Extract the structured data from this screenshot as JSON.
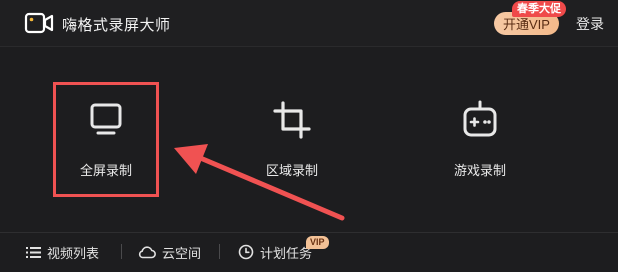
{
  "header": {
    "app_title": "嗨格式录屏大师",
    "vip_button": "开通VIP",
    "promo_badge": "春季大促",
    "login": "登录"
  },
  "options": [
    {
      "label": "全屏录制",
      "icon": "monitor-icon"
    },
    {
      "label": "区域录制",
      "icon": "crop-icon"
    },
    {
      "label": "游戏录制",
      "icon": "gamepad-icon"
    }
  ],
  "bottom": {
    "video_list": "视频列表",
    "cloud": "云空间",
    "plan": "计划任务",
    "plan_badge": "VIP"
  },
  "colors": {
    "background": "#1d1d1f",
    "highlight": "#f05252",
    "vip_gold": "#f3b98a",
    "promo_red": "#ef4a4a"
  }
}
